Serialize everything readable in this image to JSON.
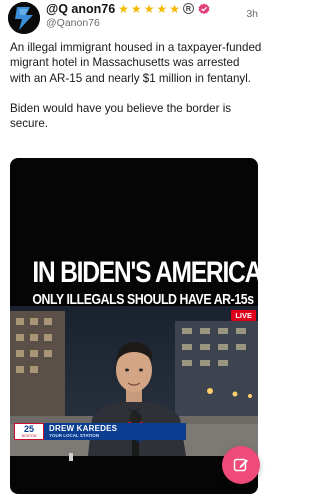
{
  "post": {
    "display_name": "@Q anon76",
    "handle": "@Qanon76",
    "time_ago": "3h",
    "badges": [
      "star-icon",
      "star-icon",
      "star-icon",
      "star-icon",
      "star-icon",
      "registered-icon",
      "verified-icon"
    ],
    "paragraphs": [
      "An illegal immigrant housed in a taxpayer-funded migrant hotel in Massachusetts was arrested with an AR-15 and nearly $1 million in fentanyl.",
      "Biden would have you believe the border is secure."
    ]
  },
  "media": {
    "headline": "IN BIDEN'S AMERICA",
    "subline": "ONLY ILLEGALS SHOULD HAVE AR-15s",
    "live_label": "LIVE",
    "mic_flag": "25",
    "chyron": {
      "channel_number": "25",
      "channel_small": "BOSTON",
      "name": "DREW KAREDES",
      "subtitle": "YOUR LOCAL STATION"
    }
  },
  "fab": {
    "icon": "edit-icon"
  },
  "colors": {
    "star": "#f5b800",
    "verified": "#e0407a",
    "fab": "#ee4a7a",
    "live": "#e0001b",
    "chyron": "#0b3d91"
  }
}
